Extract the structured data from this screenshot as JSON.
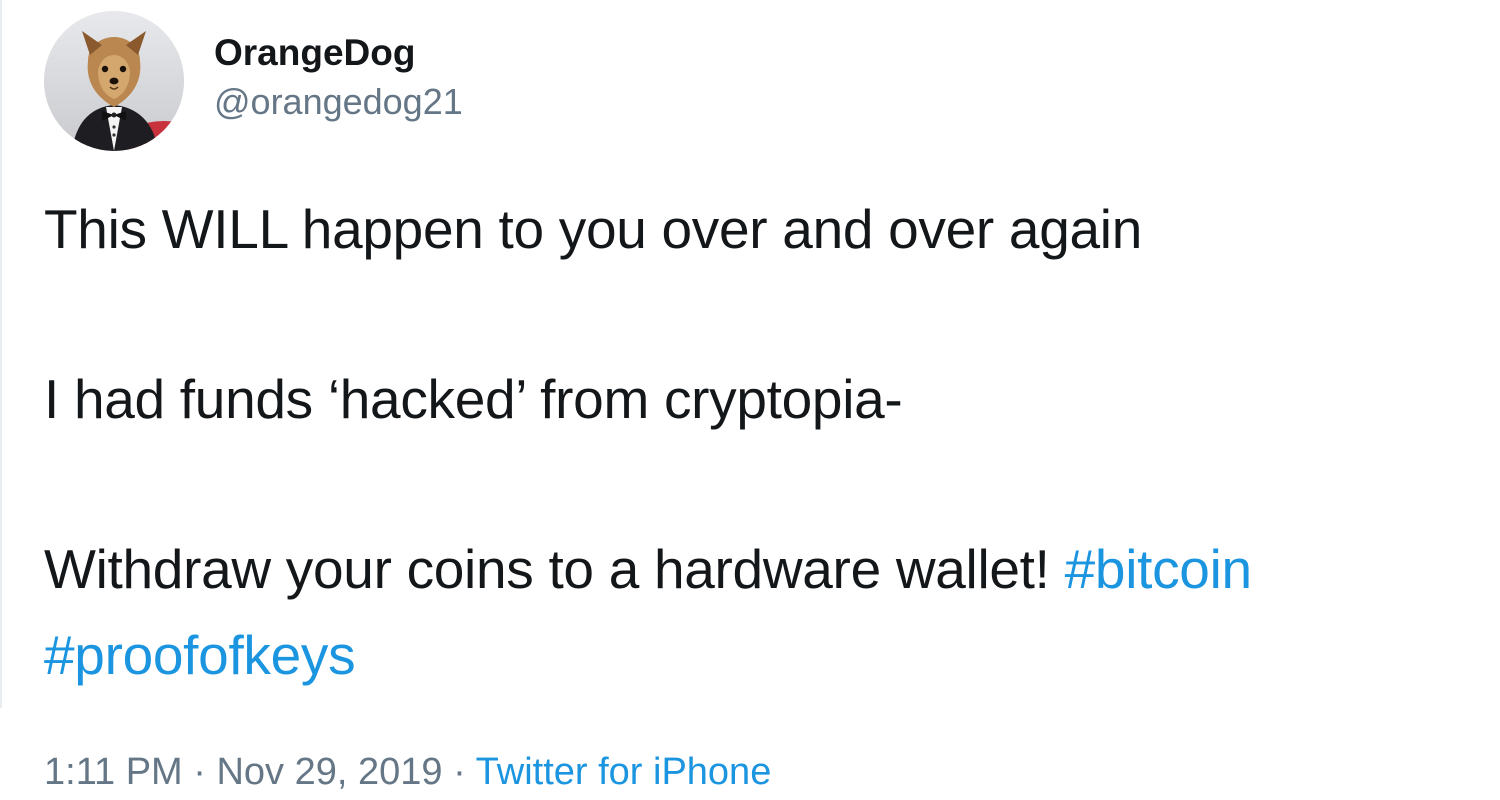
{
  "tweet": {
    "author": {
      "display_name": "OrangeDog",
      "handle": "@orangedog21",
      "avatar_icon": "yorkshire-terrier-avatar"
    },
    "text": {
      "line1": "This WILL happen to you over and over again",
      "line2": "I had funds ‘hacked’ from cryptopia-",
      "line3_text": "Withdraw your coins to a hardware wallet! ",
      "hashtag1": "#bitcoin",
      "hashtag2": "#proofofkeys"
    },
    "meta": {
      "time": "1:11 PM",
      "separator": "·",
      "date": "Nov 29, 2019",
      "source": "Twitter for iPhone"
    }
  },
  "colors": {
    "text": "#14171a",
    "secondary": "#657786",
    "link": "#1b95e0",
    "border": "#e6ecf0"
  }
}
